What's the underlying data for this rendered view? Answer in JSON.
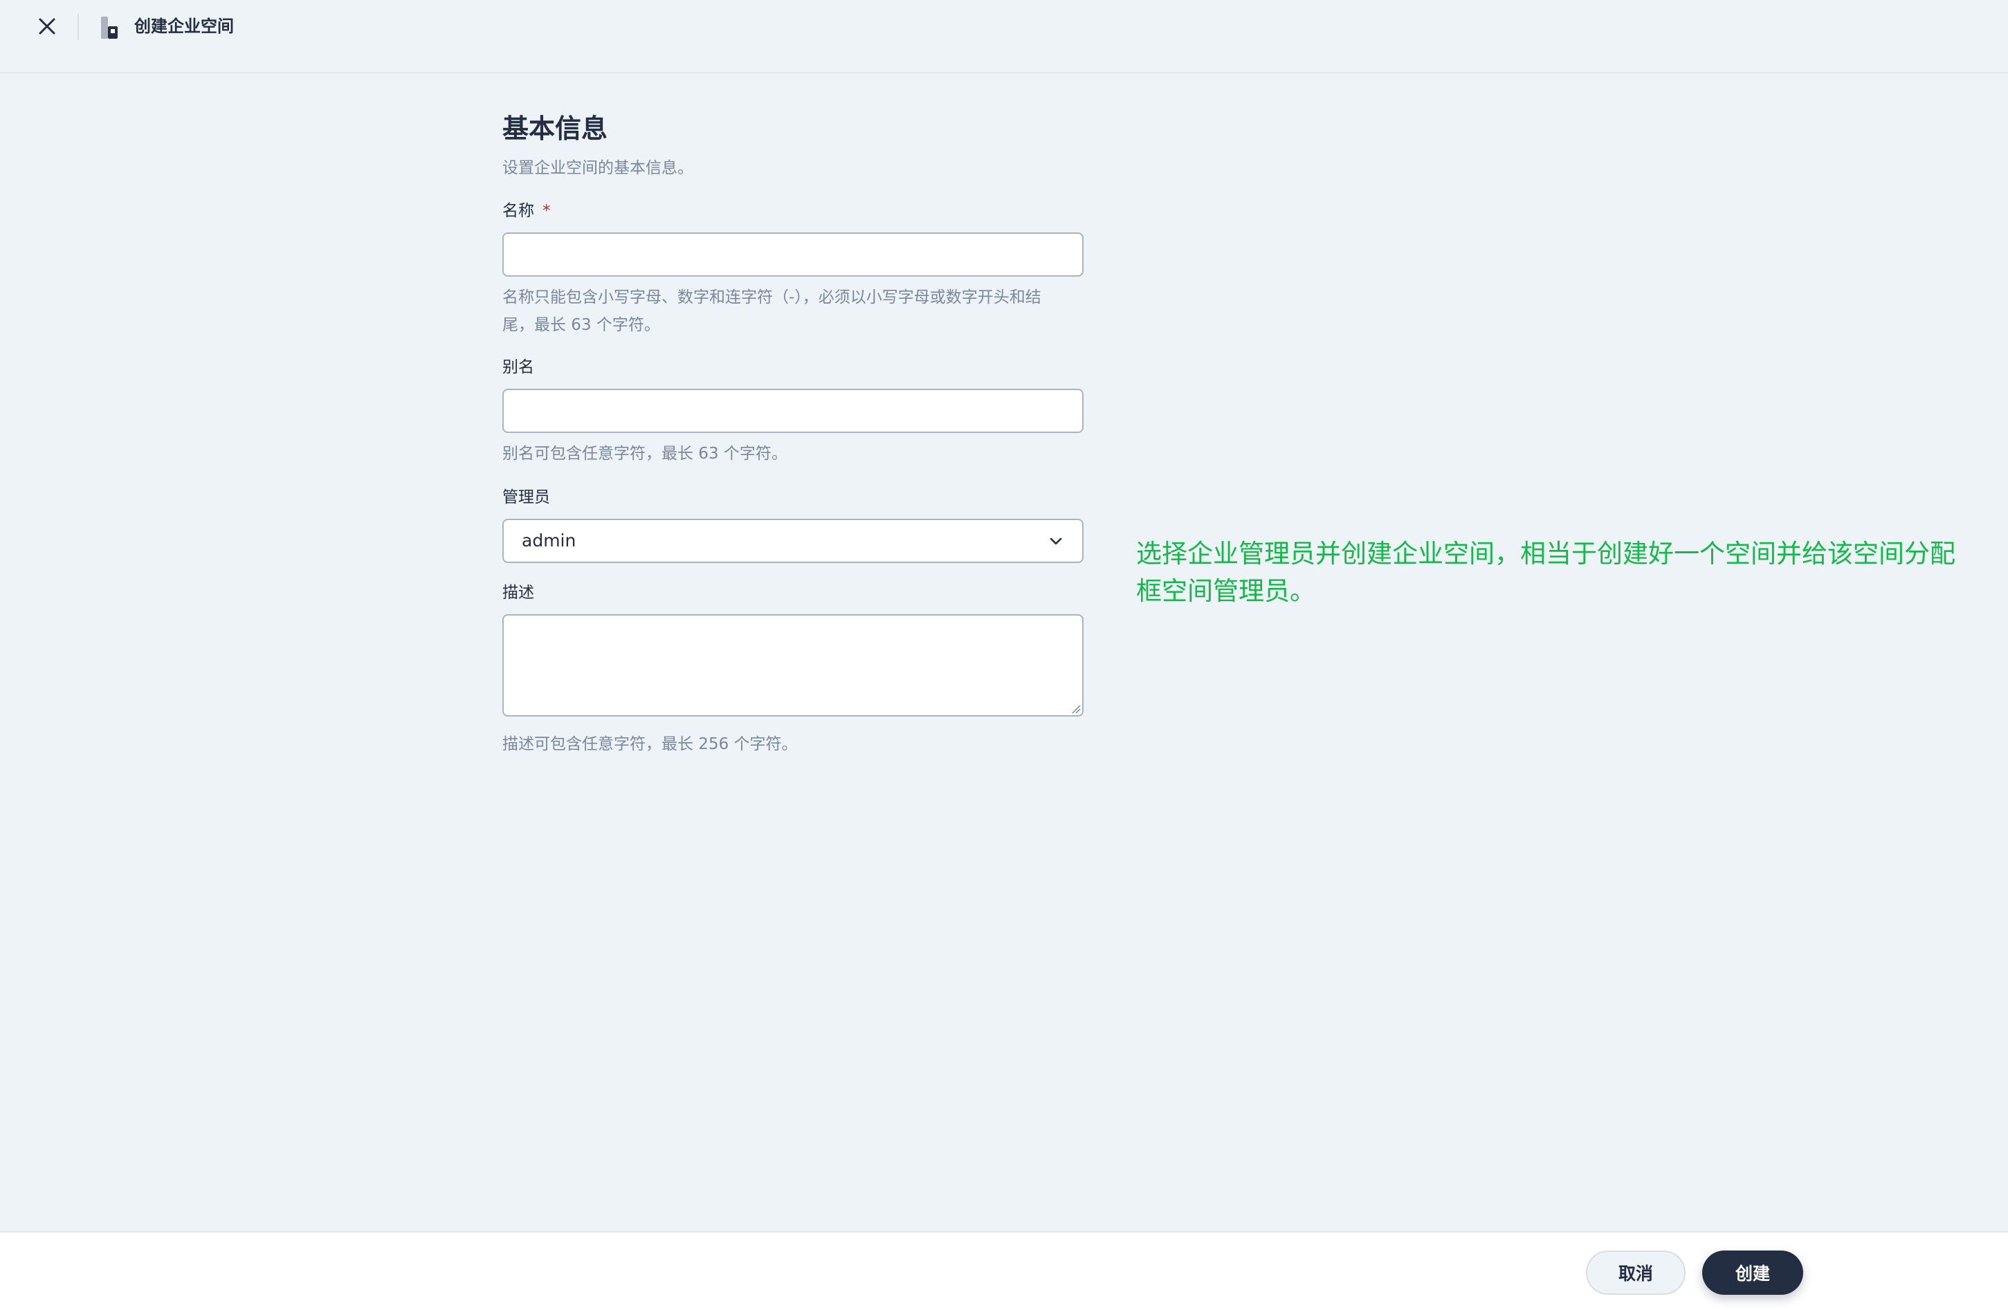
{
  "header": {
    "title": "创建企业空间"
  },
  "form": {
    "section_title": "基本信息",
    "section_description": "设置企业空间的基本信息。",
    "name": {
      "label": "名称",
      "required_mark": "*",
      "value": "",
      "hint_line1": "名称只能包含小写字母、数字和连字符（-），必须以小写字母或数字开头和结",
      "hint_line2": "尾，最长 63 个字符。"
    },
    "alias": {
      "label": "别名",
      "value": "",
      "hint": "别名可包含任意字符，最长 63 个字符。"
    },
    "admin": {
      "label": "管理员",
      "selected": "admin"
    },
    "description": {
      "label": "描述",
      "value": "",
      "hint": "描述可包含任意字符，最长 256 个字符。"
    }
  },
  "annotation": {
    "text_line1": "选择企业管理员并创建企业空间，相当于创建好一个空间并给该空间分配",
    "text_line2": "框空间管理员。",
    "color": "#14b94a"
  },
  "footer": {
    "cancel_label": "取消",
    "create_label": "创建"
  },
  "icons": {
    "close": "close-icon",
    "workspace": "workspace-icon",
    "chevron": "chevron-down-icon"
  }
}
